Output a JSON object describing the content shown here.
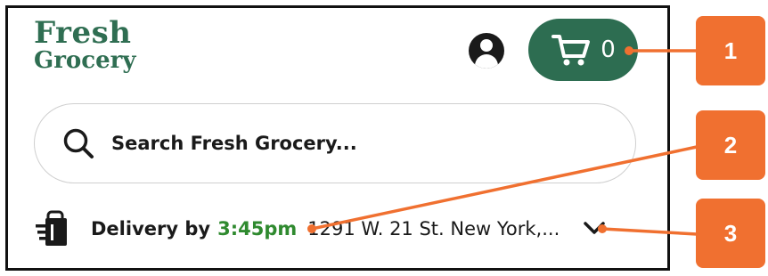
{
  "header": {
    "logo_line1": "Fresh",
    "logo_line2": "Grocery",
    "cart_count": "0"
  },
  "search": {
    "placeholder": "Search Fresh Grocery..."
  },
  "delivery": {
    "label": "Delivery by",
    "time": "3:45pm",
    "address": "1291 W. 21 St. New York,..."
  },
  "callouts": [
    "1",
    "2",
    "3"
  ],
  "colors": {
    "brand_green": "#2d6d51",
    "time_green": "#2f8a2f",
    "callout_orange": "#f07030"
  },
  "icons": [
    "account-icon",
    "cart-icon",
    "search-icon",
    "shopping-bag-icon",
    "chevron-down-icon"
  ]
}
